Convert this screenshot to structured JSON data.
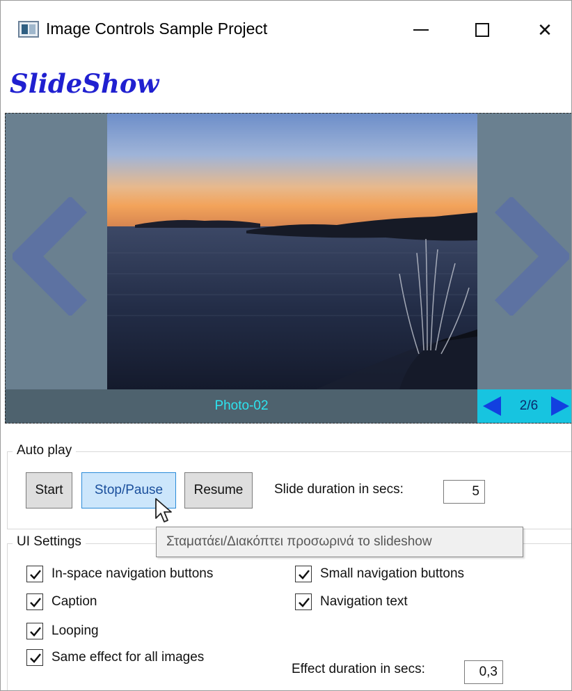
{
  "window": {
    "title": "Image Controls Sample Project",
    "minimize_icon": "minimize-icon",
    "maximize_icon": "maximize-icon",
    "close_glyph": "✕"
  },
  "slideshow": {
    "title": "SlideShow",
    "caption": "Photo-02",
    "nav_text": "2/6",
    "current_index": 2,
    "total": 6,
    "colors": {
      "background": "#6a8090",
      "caption_bar": "#4e626e",
      "caption_text": "#2de4f0",
      "nav_panel": "#17c4e0",
      "small_arrow": "#1240e0",
      "big_arrow": "#5a6ea8"
    }
  },
  "auto_play": {
    "group_label": "Auto play",
    "start_label": "Start",
    "stop_label": "Stop/Pause",
    "resume_label": "Resume",
    "slide_duration_label": "Slide duration in secs:",
    "slide_duration_value": "5"
  },
  "tooltip": {
    "text": "Σταματάει/Διακόπτει προσωρινά το slideshow"
  },
  "ui_settings": {
    "group_label": "UI Settings",
    "options": [
      {
        "label": "In-space navigation buttons",
        "checked": true
      },
      {
        "label": "Caption",
        "checked": true
      },
      {
        "label": "Looping",
        "checked": true
      },
      {
        "label": "Same effect for all images",
        "checked": true
      },
      {
        "label": "Small navigation buttons",
        "checked": true
      },
      {
        "label": "Navigation text",
        "checked": true
      }
    ],
    "effect_duration_label": "Effect duration in secs:",
    "effect_duration_value": "0,3"
  }
}
